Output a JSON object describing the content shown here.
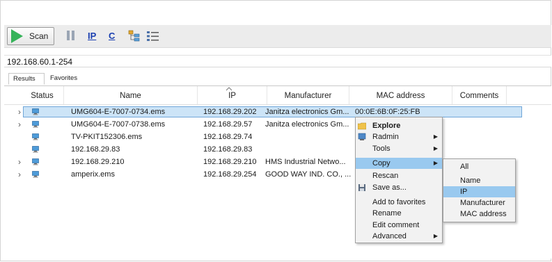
{
  "toolbar": {
    "scan_label": "Scan",
    "ip_icon_label": "IP",
    "c_icon_label": "C"
  },
  "address": "192.168.60.1-254",
  "tabs": [
    "Results",
    "Favorites"
  ],
  "columns": [
    "Status",
    "Name",
    "IP",
    "Manufacturer",
    "MAC address",
    "Comments"
  ],
  "rows": [
    {
      "expandable": true,
      "name": "UMG604-E-7007-0734.ems",
      "ip": "192.168.29.202",
      "manufacturer": "Janitza electronics Gm...",
      "mac": "00:0E:6B:0F:25:FB",
      "comments": "",
      "selected": true
    },
    {
      "expandable": true,
      "name": "UMG604-E-7007-0738.ems",
      "ip": "192.168.29.57",
      "manufacturer": "Janitza electronics Gm...",
      "mac": "",
      "comments": "",
      "selected": false
    },
    {
      "expandable": false,
      "name": "TV-PKIT152306.ems",
      "ip": "192.168.29.74",
      "manufacturer": "",
      "mac": "",
      "comments": "",
      "selected": false
    },
    {
      "expandable": false,
      "name": "192.168.29.83",
      "ip": "192.168.29.83",
      "manufacturer": "",
      "mac": "",
      "comments": "",
      "selected": false
    },
    {
      "expandable": true,
      "name": "192.168.29.210",
      "ip": "192.168.29.210",
      "manufacturer": "HMS Industrial Netwo...",
      "mac": "",
      "comments": "",
      "selected": false
    },
    {
      "expandable": true,
      "name": "amperix.ems",
      "ip": "192.168.29.254",
      "manufacturer": "GOOD WAY IND. CO., ...",
      "mac": "",
      "comments": "",
      "selected": false
    }
  ],
  "context_menu": {
    "items": [
      "Explore",
      "Radmin",
      "Tools",
      "Copy",
      "Rescan",
      "Save as...",
      "Add to favorites",
      "Rename",
      "Edit comment",
      "Advanced"
    ]
  },
  "copy_submenu": {
    "items": [
      "All",
      "Name",
      "IP",
      "Manufacturer",
      "MAC address"
    ],
    "highlighted": "IP"
  },
  "colors": {
    "accent_green": "#36b35a",
    "selection_bg": "#cce4f7",
    "menu_highlight": "#99c9ef",
    "icon_blue": "#1a3fb0"
  }
}
